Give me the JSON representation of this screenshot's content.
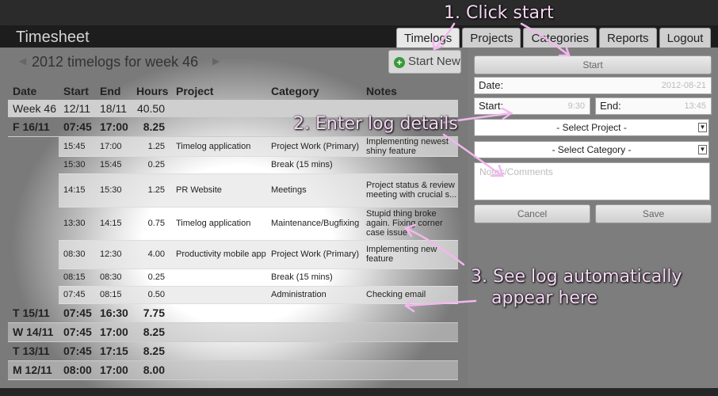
{
  "app": {
    "title": "Timesheet"
  },
  "nav": {
    "tabs": [
      "Timelogs",
      "Projects",
      "Categories",
      "Reports",
      "Logout"
    ]
  },
  "week": {
    "title": "2012 timelogs for week 46",
    "start_new": "Start New"
  },
  "table": {
    "headers": [
      "Date",
      "Start",
      "End",
      "Hours",
      "Project",
      "Category",
      "Notes"
    ],
    "week_row": {
      "label": "Week 46",
      "start": "12/11",
      "end": "18/11",
      "hours": "40.50"
    },
    "days": [
      {
        "label": "F 16/11",
        "start": "07:45",
        "end": "17:00",
        "hours": "8.25"
      },
      {
        "label": "T 15/11",
        "start": "07:45",
        "end": "16:30",
        "hours": "7.75"
      },
      {
        "label": "W 14/11",
        "start": "07:45",
        "end": "17:00",
        "hours": "8.25"
      },
      {
        "label": "T 13/11",
        "start": "07:45",
        "end": "17:15",
        "hours": "8.25"
      },
      {
        "label": "M 12/11",
        "start": "08:00",
        "end": "17:00",
        "hours": "8.00"
      }
    ],
    "logs": [
      {
        "start": "15:45",
        "end": "17:00",
        "hours": "1.25",
        "project": "Timelog application",
        "category": "Project Work (Primary)",
        "notes": "Implementing newest shiny feature"
      },
      {
        "start": "15:30",
        "end": "15:45",
        "hours": "0.25",
        "project": "",
        "category": "Break (15 mins)",
        "notes": ""
      },
      {
        "start": "14:15",
        "end": "15:30",
        "hours": "1.25",
        "project": "PR Website",
        "category": "Meetings",
        "notes": "Project status & review meeting with crucial s..."
      },
      {
        "start": "13:30",
        "end": "14:15",
        "hours": "0.75",
        "project": "Timelog application",
        "category": "Maintenance/Bugfixing",
        "notes": "Stupid thing broke again. Fixing corner case issue"
      },
      {
        "start": "08:30",
        "end": "12:30",
        "hours": "4.00",
        "project": "Productivity mobile app",
        "category": "Project Work (Primary)",
        "notes": "Implementing new feature"
      },
      {
        "start": "08:15",
        "end": "08:30",
        "hours": "0.25",
        "project": "",
        "category": "Break (15 mins)",
        "notes": ""
      },
      {
        "start": "07:45",
        "end": "08:15",
        "hours": "0.50",
        "project": "",
        "category": "Administration",
        "notes": "Checking email"
      }
    ]
  },
  "form": {
    "start_button": "Start",
    "date_label": "Date:",
    "date_value": "2012-08-21",
    "start_label": "Start:",
    "start_value": "9:30",
    "end_label": "End:",
    "end_value": "13:45",
    "project_select": "- Select Project -",
    "category_select": "- Select Category -",
    "notes_placeholder": "Notes/Comments",
    "cancel": "Cancel",
    "save": "Save"
  },
  "callouts": {
    "step1": "1. Click start",
    "step2": "2. Enter log details",
    "step3_line1": "3. See log automatically",
    "step3_line2": "appear here"
  },
  "colors": {
    "callout_text": "#f7d7f5",
    "arrow": "#f2b8ee",
    "add_icon": "#3a9a3a"
  }
}
